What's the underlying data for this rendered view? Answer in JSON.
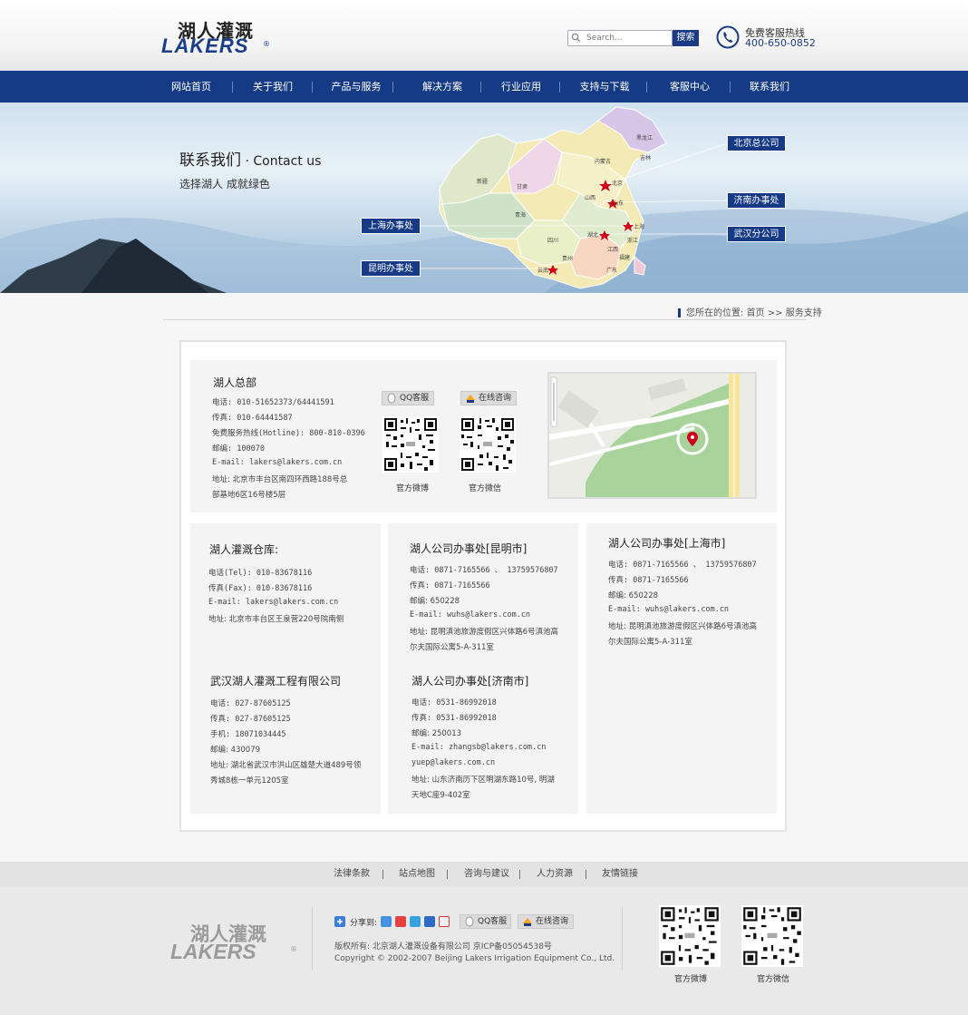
{
  "header": {
    "logo_cn": "湖人灌溉",
    "logo_en": "LAKERS",
    "logo_reg": "®",
    "search_placeholder": "Search...",
    "search_button": "搜索",
    "hotline_label": "免费客服热线",
    "hotline_number": "400-650-0852"
  },
  "nav": {
    "items": [
      "网站首页",
      "关于我们",
      "产品与服务",
      "解决方案",
      "行业应用",
      "支持与下载",
      "客服中心",
      "联系我们"
    ]
  },
  "banner": {
    "title_cn": "联系我们",
    "title_en": " · Contact us",
    "subtitle": "选择湖人 成就绿色",
    "offices": [
      "北京总公司",
      "济南办事处",
      "武汉分公司",
      "上海办事处",
      "昆明办事处"
    ],
    "map_labels": [
      "黑龙江",
      "吉林",
      "内蒙古",
      "北京",
      "新疆",
      "甘肃",
      "山西",
      "山东",
      "青海",
      "上海",
      "湖北",
      "四川",
      "浙江",
      "江西",
      "贵州",
      "福建",
      "云南",
      "广东"
    ]
  },
  "breadcrumb": {
    "prefix": "您所在的位置:",
    "home": "首页",
    "sep": ">>",
    "current": "服务支持"
  },
  "hq": {
    "title": "湖人总部",
    "lines": [
      "电话: 010-51652373/64441591",
      "传真: 010-64441587",
      "免费服务热线(Hotline): 800-810-0396",
      "邮编: 100070",
      "E-mail: lakers@lakers.com.cn",
      "地址: 北京市丰台区南四环西路188号总",
      "部基地6区16号楼5层"
    ],
    "qq_button": "QQ客服",
    "online_button": "在线咨询",
    "qr_weibo": "官方微博",
    "qr_weixin": "官方微信"
  },
  "offices": [
    {
      "title": "湖人灌溉仓库:",
      "lines": [
        "电话(Tel): 010-83678116",
        "传真(Fax): 010-83678116",
        "E-mail: lakers@lakers.com.cn",
        "地址: 北京市丰台区王泉营220号院南侧"
      ]
    },
    {
      "title": "湖人公司办事处[昆明市]",
      "lines": [
        "电话: 0871-7165566 、 13759576807",
        "传真: 0871-7165566",
        "邮编: 650228",
        "E-mail: wuhs@lakers.com.cn",
        "地址: 昆明滇池旅游度假区兴体路6号滇池高",
        "尔夫国际公寓5-A-311室"
      ]
    },
    {
      "title": "湖人公司办事处[上海市]",
      "lines": [
        "电话: 0871-7165566 、 13759576807",
        "传真: 0871-7165566",
        "邮编: 650228",
        "E-mail: wuhs@lakers.com.cn",
        "地址: 昆明滇池旅游度假区兴体路6号滇池高",
        "尔夫国际公寓5-A-311室"
      ]
    },
    {
      "title": "武汉湖人灌溉工程有限公司",
      "lines": [
        "电话: 027-87605125",
        "传真: 027-87605125",
        "手机: 18071034445",
        "邮编: 430079",
        "地址: 湖北省武汉市洪山区雄楚大道489号领",
        "秀城8栋一单元1205室"
      ]
    },
    {
      "title": "湖人公司办事处[济南市]",
      "lines": [
        "电话: 0531-86992018",
        "传真: 0531-86992018",
        "邮编: 250013",
        "E-mail: zhangsb@lakers.com.cn",
        "yuep@lakers.com.cn",
        "地址: 山东济南历下区明湖东路10号, 明湖",
        "天地C座9-402室"
      ]
    }
  ],
  "footer": {
    "links": [
      "法律条款",
      "站点地图",
      "咨询与建议",
      "人力资源",
      "友情链接"
    ],
    "logo_cn": "湖人灌溉",
    "logo_en": "LAKERS",
    "logo_reg": "®",
    "share_label": "分享到:",
    "qq_button": "QQ客服",
    "online_button": "在线咨询",
    "copyright_cn": "版权所有: 北京湖人灌溉设备有限公司      京ICP备05054538号",
    "copyright_en": "Copyright © 2002-2007 Beijing Lakers Irrigation Equipment Co., Ltd.",
    "qr_weibo": "官方微博",
    "qr_weixin": "官方微信"
  },
  "colors": {
    "brand": "#153a86",
    "accent_red": "#d0021b"
  }
}
